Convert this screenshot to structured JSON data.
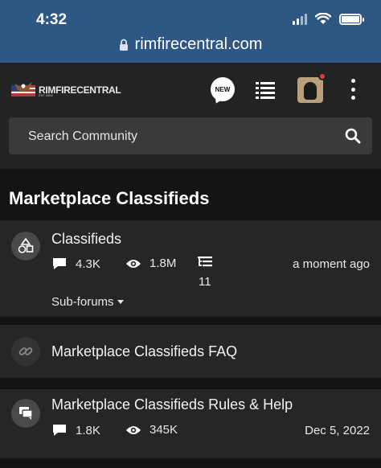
{
  "status_bar": {
    "time": "4:32"
  },
  "browser": {
    "url": "rimfirecentral.com"
  },
  "header": {
    "logo_text": "RIMFIRECENTRAL",
    "logo_sub": "EST 2000",
    "new_label": "NEW",
    "search_placeholder": "Search Community"
  },
  "section": {
    "title": "Marketplace Classifieds"
  },
  "forums": [
    {
      "title": "Classifieds",
      "icon": "shapes-icon",
      "threads": "4.3K",
      "views": "1.8M",
      "subforum_count": "11",
      "last_activity": "a moment ago",
      "subforums_label": "Sub-forums"
    },
    {
      "title": "Marketplace Classifieds FAQ",
      "icon": "link-icon"
    },
    {
      "title": "Marketplace Classifieds Rules & Help",
      "icon": "chat-icon",
      "threads": "1.8K",
      "views": "345K",
      "last_activity": "Dec 5, 2022"
    }
  ],
  "colors": {
    "browser_bar": "#2e5784",
    "header_bg": "#232323",
    "card_bg": "#262626",
    "page_bg": "#141414",
    "notification": "#e53b3b"
  }
}
